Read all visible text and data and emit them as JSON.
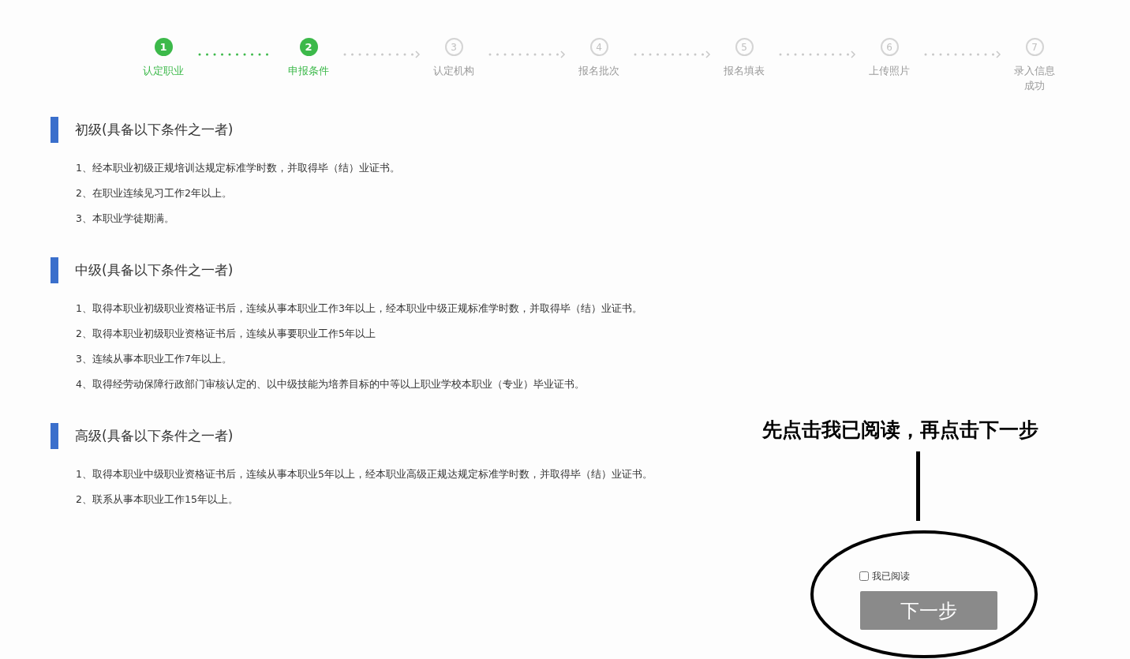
{
  "stepper": {
    "steps": [
      {
        "number": "1",
        "label": "认定职业",
        "completed": true
      },
      {
        "number": "2",
        "label": "申报条件",
        "completed": true
      },
      {
        "number": "3",
        "label": "认定机构",
        "completed": false
      },
      {
        "number": "4",
        "label": "报名批次",
        "completed": false
      },
      {
        "number": "5",
        "label": "报名填表",
        "completed": false
      },
      {
        "number": "6",
        "label": "上传照片",
        "completed": false
      },
      {
        "number": "7",
        "label": "录入信息成功",
        "completed": false
      }
    ]
  },
  "sections": [
    {
      "title": "初级(具备以下条件之一者)",
      "items": [
        "1、经本职业初级正规培训达规定标准学时数，并取得毕（结）业证书。",
        "2、在职业连续见习工作2年以上。",
        "3、本职业学徒期满。"
      ]
    },
    {
      "title": "中级(具备以下条件之一者)",
      "items": [
        "1、取得本职业初级职业资格证书后，连续从事本职业工作3年以上，经本职业中级正规标准学时数，并取得毕（结）业证书。",
        "2、取得本职业初级职业资格证书后，连续从事要职业工作5年以上",
        "3、连续从事本职业工作7年以上。",
        "4、取得经劳动保障行政部门审核认定的、以中级技能为培养目标的中等以上职业学校本职业（专业）毕业证书。"
      ]
    },
    {
      "title": "高级(具备以下条件之一者)",
      "items": [
        "1、取得本职业中级职业资格证书后，连续从事本职业5年以上，经本职业高级正规达规定标准学时数，并取得毕（结）业证书。",
        "2、联系从事本职业工作15年以上。"
      ]
    }
  ],
  "annotation": {
    "text": "先点击我已阅读，再点击下一步"
  },
  "agreement": {
    "label": "我已阅读",
    "checked": false
  },
  "next_button": {
    "label": "下一步",
    "disabled": true
  }
}
